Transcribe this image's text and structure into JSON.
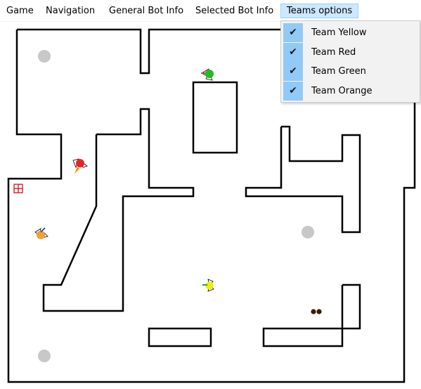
{
  "menubar": {
    "items": [
      {
        "label": "Game"
      },
      {
        "label": "Navigation"
      },
      {
        "label": "General Bot Info"
      },
      {
        "label": "Selected Bot Info"
      },
      {
        "label": "Teams options"
      }
    ]
  },
  "teams_menu": {
    "open": true,
    "items": [
      {
        "label": "Team Yellow",
        "checked": true
      },
      {
        "label": "Team Red",
        "checked": true
      },
      {
        "label": "Team Green",
        "checked": true
      },
      {
        "label": "Team Orange",
        "checked": true
      }
    ],
    "check_glyph": "✔"
  },
  "colors": {
    "menu_active_bg": "#cce8ff",
    "check_bg": "#91c9f7",
    "wall": "#000000",
    "spawn_marker": "#c8c8c8",
    "bot_red": "#ee2222",
    "bot_green": "#22bb22",
    "bot_yellow": "#eeee00",
    "bot_orange": "#f4a030",
    "health_pack": "#cc0000"
  },
  "map": {
    "bots": [
      {
        "team": "Red",
        "icon": "red-bot-icon"
      },
      {
        "team": "Green",
        "icon": "green-bot-icon"
      },
      {
        "team": "Yellow",
        "icon": "yellow-bot-icon"
      },
      {
        "team": "Orange",
        "icon": "orange-bot-icon"
      }
    ],
    "items": [
      {
        "type": "health-pack",
        "icon": "health-pack-icon"
      },
      {
        "type": "ammo",
        "icon": "ammo-icon"
      }
    ]
  }
}
